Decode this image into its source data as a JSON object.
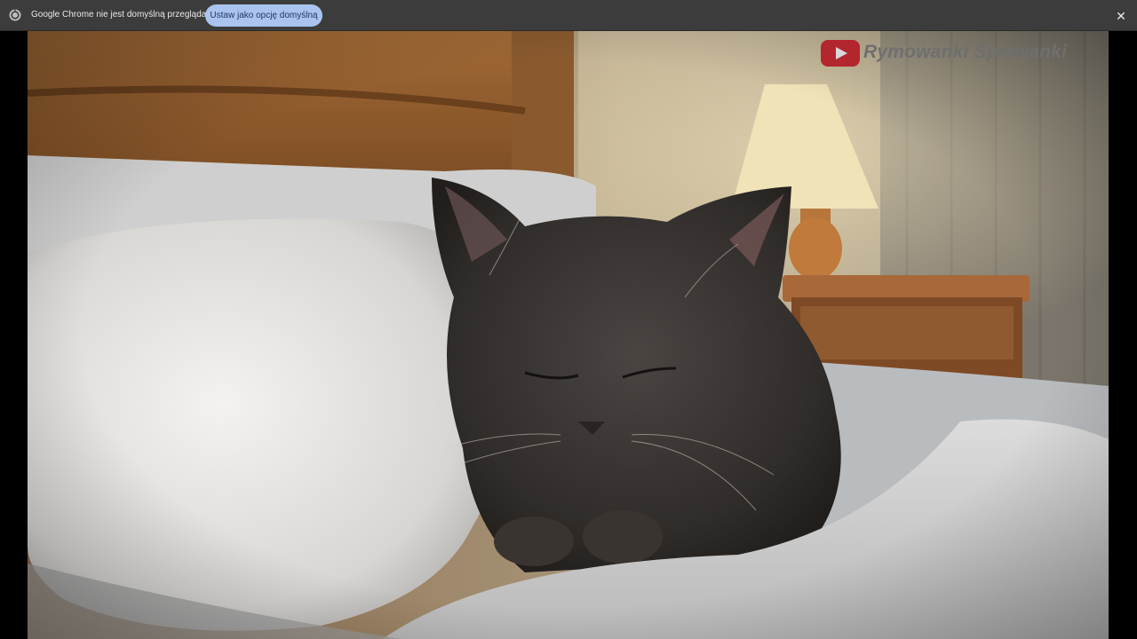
{
  "infobar": {
    "message": "Google Chrome nie jest domyślną przeglądarką",
    "button_label": "Ustaw jako opcję domyślną",
    "close_symbol": "✕",
    "chrome_icon": "chrome-icon",
    "close_icon": "close-icon"
  },
  "video": {
    "watermark_channel": "Rymowanki Śpiewanki",
    "watermark_logo": "youtube-play-icon",
    "scene": "kitten-sleeping-on-pillow"
  },
  "colors": {
    "infobar_bg": "#3c3c3c",
    "button_bg": "#a8c4ef",
    "button_text": "#1f3a64",
    "youtube_red": "#b3262d"
  }
}
